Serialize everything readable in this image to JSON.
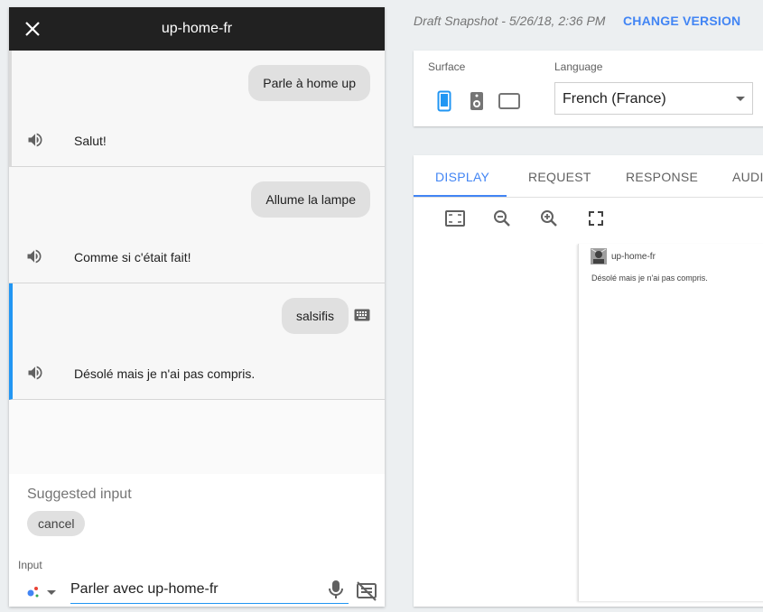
{
  "simulator": {
    "title": "up-home-fr",
    "turns": [
      {
        "user": "Parle à home up",
        "reply": "Salut!"
      },
      {
        "user": "Allume la lampe",
        "reply": "Comme si c'était fait!"
      },
      {
        "user": "salsifis",
        "reply": "Désolé mais je n'ai pas compris."
      }
    ],
    "suggested_title": "Suggested input",
    "chips": [
      "cancel"
    ],
    "input_label": "Input",
    "input_value": "Parler avec up-home-fr"
  },
  "header": {
    "snapshot": "Draft Snapshot - 5/26/18, 2:36 PM",
    "change_version": "CHANGE VERSION"
  },
  "settings": {
    "surface_label": "Surface",
    "language_label": "Language",
    "language_value": "French (France)",
    "selected_surface": "phone"
  },
  "tabs": [
    "DISPLAY",
    "REQUEST",
    "RESPONSE",
    "AUDIO"
  ],
  "active_tab": "DISPLAY",
  "preview": {
    "name": "up-home-fr",
    "text": "Désolé mais je n'ai pas compris."
  },
  "colors": {
    "accent": "#4285f4",
    "active_turn": "#2196f3",
    "header_bg": "#212121"
  }
}
